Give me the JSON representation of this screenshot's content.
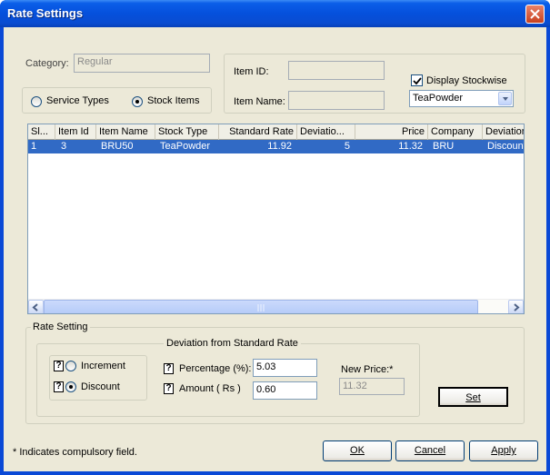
{
  "window": {
    "title": "Rate Settings"
  },
  "category": {
    "label": "Category:",
    "value": "Regular"
  },
  "item_type": {
    "options": [
      {
        "label": "Service Types",
        "selected": false
      },
      {
        "label": "Stock Items",
        "selected": true
      }
    ]
  },
  "item_filter": {
    "item_id_label": "Item ID:",
    "item_id_value": "",
    "item_name_label": "Item Name:",
    "item_name_value": "",
    "display_stockwise_label": "Display Stockwise",
    "display_stockwise_checked": true,
    "stock_type_selected": "TeaPowder"
  },
  "grid": {
    "columns": [
      "Sl...",
      "Item Id",
      "Item Name",
      "Stock Type",
      "Standard Rate",
      "Deviatio...",
      "Price",
      "Company",
      "Deviation"
    ],
    "rows": [
      {
        "sl": "1",
        "item_id": "3",
        "item_name": "BRU50",
        "stock_type": "TeaPowder",
        "standard_rate": "11.92",
        "deviation": "5",
        "price": "11.32",
        "company": "BRU",
        "deviation_type": "Discount"
      }
    ]
  },
  "rate_setting": {
    "group_label": "Rate Setting",
    "deviation_group_label": "Deviation from Standard Rate",
    "increment_label": "Increment",
    "discount_label": "Discount",
    "mode": "discount",
    "percentage_label": "Percentage (%):",
    "percentage_value": "5.03",
    "amount_label": "Amount ( Rs )",
    "amount_value": "0.60",
    "new_price_label": "New  Price:*",
    "new_price_value": "11.32",
    "set_label": "Set",
    "help_glyph": "?"
  },
  "footer": {
    "note": "* Indicates compulsory field.",
    "ok_label": "OK",
    "cancel_label": "Cancel",
    "apply_label": "Apply"
  }
}
